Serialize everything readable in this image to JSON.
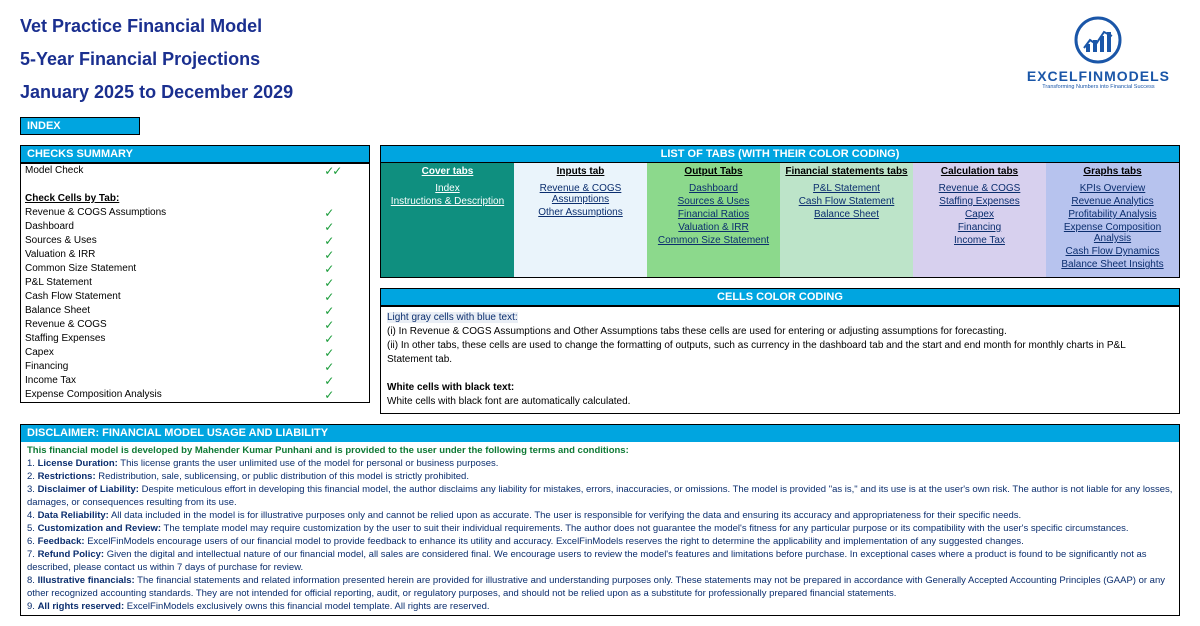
{
  "titles": {
    "line1": "Vet Practice Financial Model",
    "line2": "5-Year Financial Projections",
    "line3": "January 2025 to December 2029"
  },
  "brand": {
    "name": "EXCELFINMODELS",
    "tagline": "Transforming Numbers into Financial Success"
  },
  "index_label": "INDEX",
  "checks": {
    "header": "CHECKS  SUMMARY",
    "model_check": "Model Check",
    "model_check_ticks": "✓✓",
    "by_tab_label": "Check Cells by Tab:",
    "items": [
      "Revenue & COGS Assumptions",
      "Dashboard",
      "Sources & Uses",
      "Valuation & IRR",
      "Common Size Statement",
      "P&L Statement",
      "Cash Flow Statement",
      "Balance Sheet",
      "Revenue & COGS",
      "Staffing Expenses",
      "Capex",
      "Financing",
      "Income Tax",
      "Expense Composition Analysis"
    ],
    "tick": "✓"
  },
  "tabs": {
    "header": "LIST OF TABS (WITH THEIR COLOR CODING)",
    "cols": [
      {
        "head": "Cover tabs",
        "links": [
          "Index",
          "Instructions & Description"
        ]
      },
      {
        "head": "Inputs tab",
        "links": [
          "Revenue & COGS Assumptions",
          "Other Assumptions"
        ]
      },
      {
        "head": "Output Tabs",
        "links": [
          "Dashboard",
          "Sources & Uses",
          "Financial Ratios",
          "Valuation & IRR",
          "Common Size Statement"
        ]
      },
      {
        "head": "Financial statements tabs",
        "links": [
          "P&L Statement",
          "Cash Flow Statement",
          "Balance Sheet"
        ]
      },
      {
        "head": "Calculation tabs",
        "links": [
          "Revenue & COGS",
          "Staffing Expenses",
          "Capex",
          "Financing",
          "Income Tax"
        ]
      },
      {
        "head": "Graphs tabs",
        "links": [
          "KPIs Overview",
          "Revenue Analytics",
          "Profitability Analysis",
          "Expense Composition Analysis",
          "Cash Flow Dynamics",
          "Balance Sheet Insights"
        ]
      }
    ]
  },
  "cells": {
    "header": "CELLS COLOR CODING",
    "l1": "Light gray cells with blue text:",
    "l2": "(i) In Revenue & COGS Assumptions and Other Assumptions tabs these cells are used for entering or adjusting assumptions for forecasting.",
    "l3": "(ii) In other tabs, these cells are used to change the formatting of outputs, such as currency in the dashboard tab and the start and end month for monthly charts in P&L Statement tab.",
    "l4": "White cells with black text:",
    "l5": "White cells with black font are automatically calculated."
  },
  "disclaimer": {
    "header": "DISCLAIMER: FINANCIAL MODEL USAGE AND LIABILITY",
    "intro": "This financial model  is developed by Mahender Kumar Punhani and is provided to the user under the following terms and conditions:",
    "items": [
      {
        "b": "License Duration:",
        "t": " This license grants the user unlimited use of the model for personal or business purposes."
      },
      {
        "b": "Restrictions:",
        "t": " Redistribution, sale, sublicensing, or public distribution of this model is strictly prohibited."
      },
      {
        "b": "Disclaimer of Liability:",
        "t": " Despite meticulous effort in developing this financial model, the author disclaims any liability for mistakes, errors, inaccuracies, or omissions. The model is provided \"as is,\" and its use is at the user's own risk. The author is  not liable for any  losses, damages, or consequences resulting from its use."
      },
      {
        "b": "Data Reliability:",
        "t": " All data included in the model is for illustrative purposes only and cannot be relied upon as accurate. The user is  responsible for verifying the data and ensuring its accuracy and appropriateness for their specific needs."
      },
      {
        "b": "Customization and Review:",
        "t": " The template model may require customization by the user to suit their individual requirements. The author does not guarantee the model's fitness for any  particular purpose or its compatibility with the user's specific circumstances."
      },
      {
        "b": "Feedback:",
        "t": " ExcelFinModels encourage users of our financial model to provide feedback to enhance its utility and accuracy. ExcelFinModels reserves the right to determine the applicability and implementation of any suggested changes."
      },
      {
        "b": "Refund Policy:",
        "t": " Given the digital and intellectual nature of our financial model, all sales are considered final. We encourage users to review the model's features and limitations before purchase. In exceptional cases where a product is found to be  significantly not as described, please contact us within 7 days of purchase for review."
      },
      {
        "b": "Illustrative financials:",
        "t": " The financial statements and related information presented herein are provided for illustrative and understanding purposes only. These statements may not be prepared in accordance with Generally Accepted Accounting Principles (GAAP) or any other  recognized accounting standards. They are not intended for official reporting, audit, or regulatory purposes, and should not be relied upon as a substitute for professionally prepared financial statements."
      },
      {
        "b": "All rights reserved:",
        "t": " ExcelFinModels exclusively owns this financial model template. All rights are reserved."
      }
    ]
  }
}
